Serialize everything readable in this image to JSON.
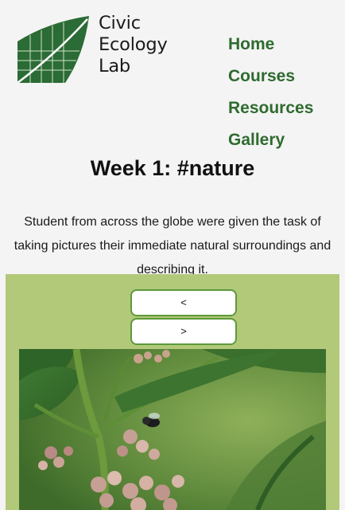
{
  "logo": {
    "lines": [
      "Civic",
      "Ecology",
      "Lab"
    ],
    "colors": {
      "leaf": "#2b6b35",
      "text": "#1b1b1b"
    }
  },
  "nav": {
    "items": [
      {
        "label": "Home"
      },
      {
        "label": "Courses"
      },
      {
        "label": "Resources"
      },
      {
        "label": "Gallery"
      }
    ],
    "color": "#2f6b2f"
  },
  "page": {
    "title": "Week 1: #nature",
    "description": "Student from across the globe were given the task of taking pictures their immediate natural surroundings and describing it."
  },
  "gallery": {
    "prev_label": "<",
    "next_label": ">",
    "background": "#b2c97a",
    "image_subject": "milkweed flowers with a bee"
  }
}
